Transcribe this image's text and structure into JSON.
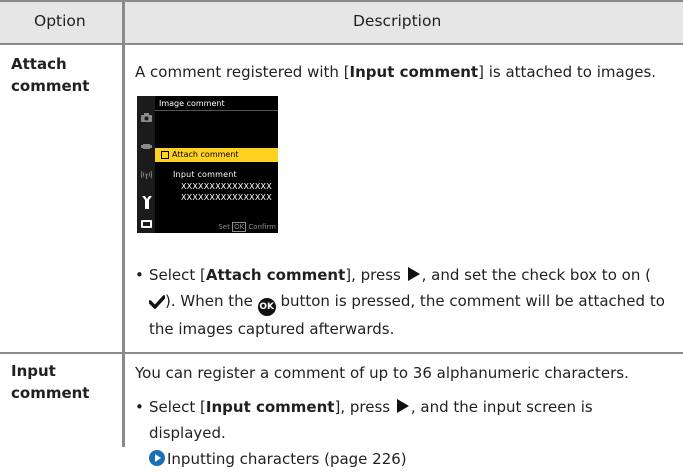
{
  "header": {
    "option": "Option",
    "description": "Description"
  },
  "rows": [
    {
      "option": "Attach comment",
      "intro_pre": "A comment registered with [",
      "intro_bold": "Input comment",
      "intro_post": "] is attached to images.",
      "screen": {
        "title": "Image comment",
        "selected_item": "Attach comment",
        "input_label": "Input comment",
        "line1": "XXXXXXXXXXXXXXXX",
        "line2": "XXXXXXXXXXXXXXXX",
        "footer_set": "Set",
        "footer_ok": "OK",
        "footer_confirm": "Confirm"
      },
      "bullet": {
        "dot": "•",
        "p1": "Select [",
        "bold": "Attach comment",
        "p2": "], press",
        "p3": ", and set the check box to on (",
        "p4": ").",
        "p5": "When the",
        "ok_label": "OK",
        "p6": "button is pressed, the comment will be attached to the images captured afterwards."
      }
    },
    {
      "option": "Input comment",
      "intro": "You can register a comment of up to 36 alphanumeric characters.",
      "bullet": {
        "dot": "•",
        "p1": "Select [",
        "bold": "Input comment",
        "p2": "], press",
        "p3": ", and the input screen is displayed.",
        "ref": "Inputting characters (page 226)"
      }
    }
  ],
  "icons": [
    "right-triangle-icon",
    "checkmark-icon",
    "ok-button-icon",
    "reference-arrow-icon",
    "camera-icon",
    "movie-icon",
    "wireless-icon",
    "wrench-icon",
    "battery-icon"
  ],
  "colors": {
    "header_bg": "#e6e6e6",
    "rule": "#8a8a8a",
    "highlight": "#ffd21f",
    "ref_arrow": "#1a6fb5"
  }
}
